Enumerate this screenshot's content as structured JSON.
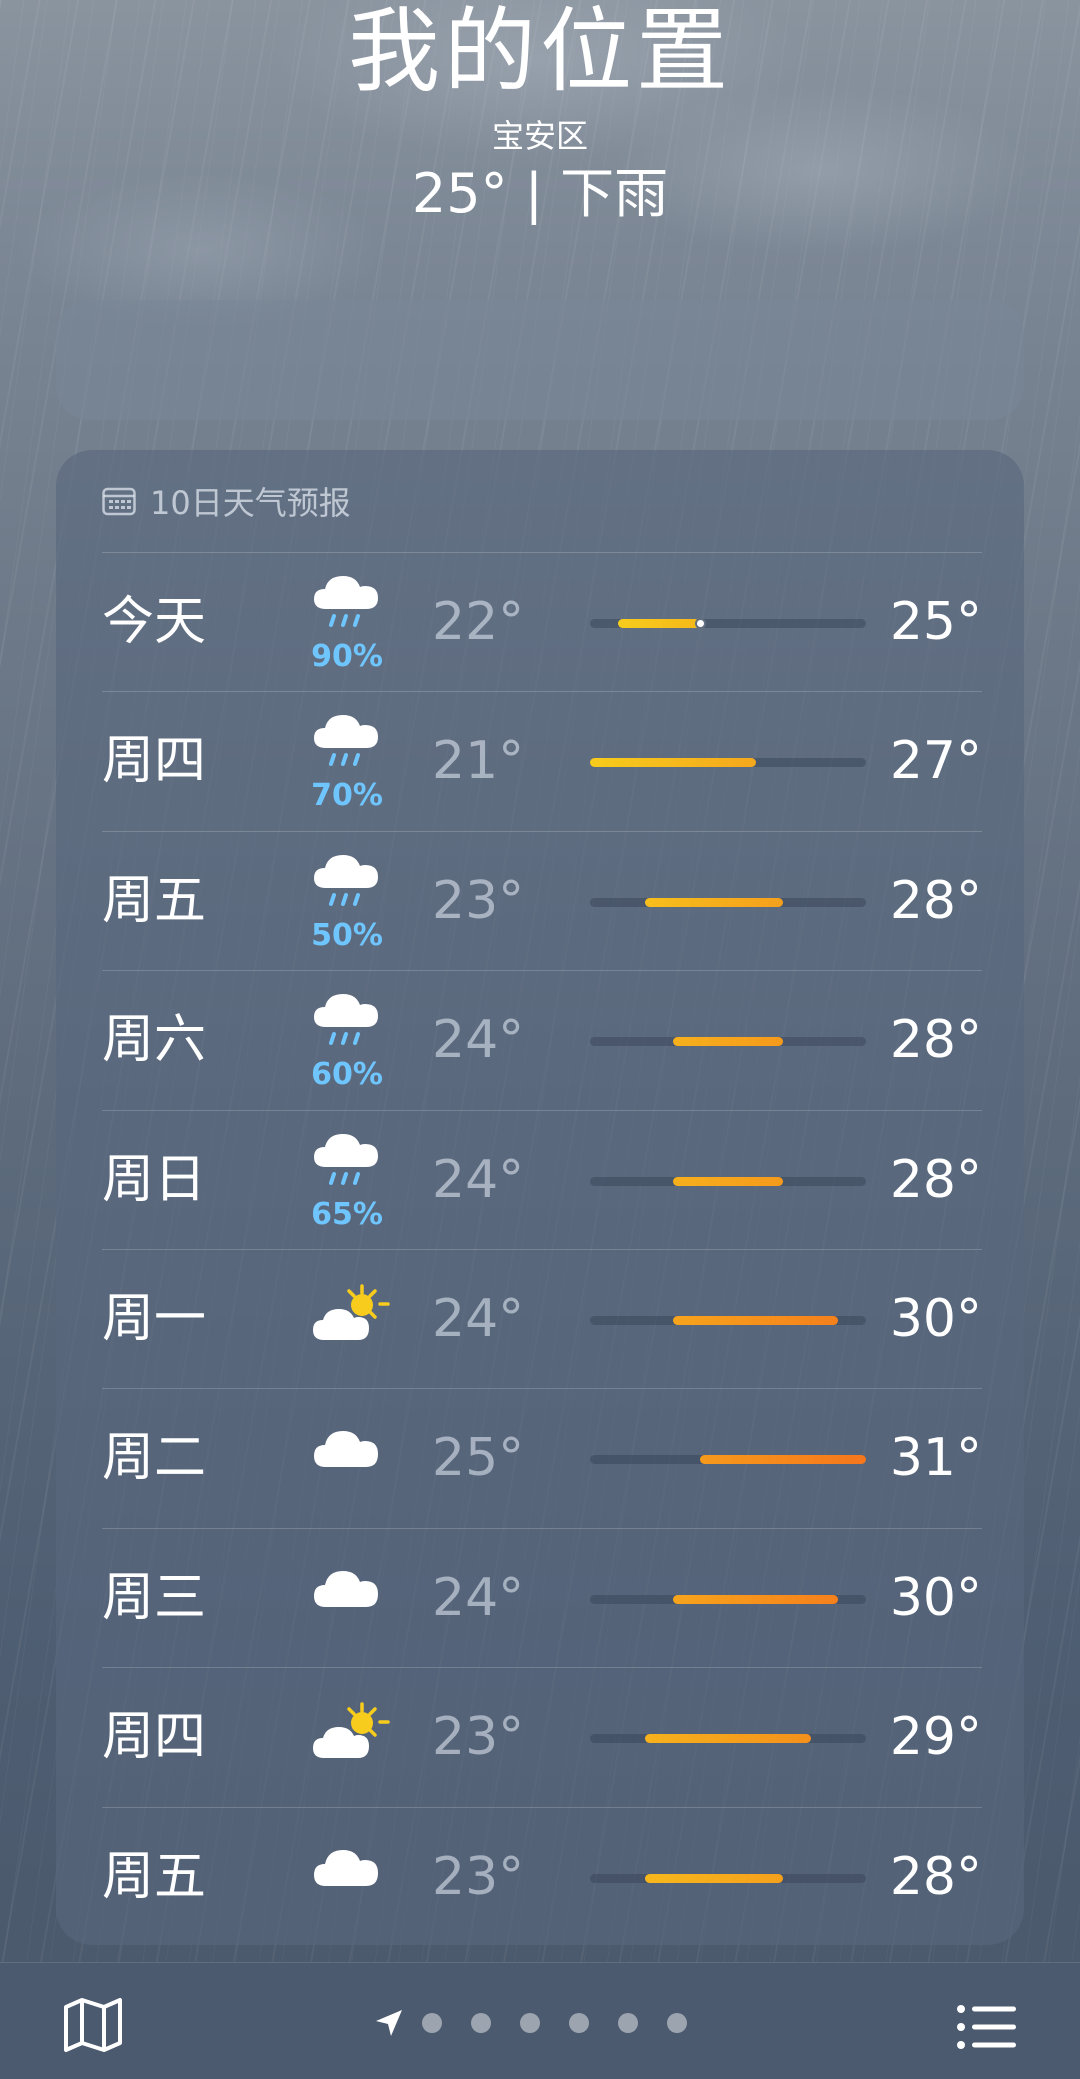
{
  "header": {
    "title": "我的位置",
    "subtitle": "宝安区",
    "current": "25° | 下雨"
  },
  "forecast": {
    "header_label": "10日天气预报",
    "header_icon": "calendar-icon",
    "range_min": 21,
    "range_max": 31,
    "current_temp": 25,
    "days": [
      {
        "day": "今天",
        "icon": "cloud-rain-icon",
        "pop": "90%",
        "low": "22°",
        "high": "25°",
        "low_v": 22,
        "high_v": 25,
        "color_a": "#f7cc1c",
        "color_b": "#f5b81a"
      },
      {
        "day": "周四",
        "icon": "cloud-rain-icon",
        "pop": "70%",
        "low": "21°",
        "high": "27°",
        "low_v": 21,
        "high_v": 27,
        "color_a": "#f7cc1c",
        "color_b": "#f5a81c"
      },
      {
        "day": "周五",
        "icon": "cloud-rain-icon",
        "pop": "50%",
        "low": "23°",
        "high": "28°",
        "low_v": 23,
        "high_v": 28,
        "color_a": "#f7bf1c",
        "color_b": "#f5a01c"
      },
      {
        "day": "周六",
        "icon": "cloud-rain-icon",
        "pop": "60%",
        "low": "24°",
        "high": "28°",
        "low_v": 24,
        "high_v": 28,
        "color_a": "#f7b01c",
        "color_b": "#f59a1c"
      },
      {
        "day": "周日",
        "icon": "cloud-rain-icon",
        "pop": "65%",
        "low": "24°",
        "high": "28°",
        "low_v": 24,
        "high_v": 28,
        "color_a": "#f7b01c",
        "color_b": "#f59a1c"
      },
      {
        "day": "周一",
        "icon": "partly-sunny-icon",
        "pop": "",
        "low": "24°",
        "high": "30°",
        "low_v": 24,
        "high_v": 30,
        "color_a": "#f7a41c",
        "color_b": "#f5801c"
      },
      {
        "day": "周二",
        "icon": "cloud-icon",
        "pop": "",
        "low": "25°",
        "high": "31°",
        "low_v": 25,
        "high_v": 31,
        "color_a": "#f79a1c",
        "color_b": "#f5761c"
      },
      {
        "day": "周三",
        "icon": "cloud-icon",
        "pop": "",
        "low": "24°",
        "high": "30°",
        "low_v": 24,
        "high_v": 30,
        "color_a": "#f7a41c",
        "color_b": "#f5801c"
      },
      {
        "day": "周四",
        "icon": "partly-sunny-icon",
        "pop": "",
        "low": "23°",
        "high": "29°",
        "low_v": 23,
        "high_v": 29,
        "color_a": "#f7b21c",
        "color_b": "#f5901c"
      },
      {
        "day": "周五",
        "icon": "cloud-icon",
        "pop": "",
        "low": "23°",
        "high": "28°",
        "low_v": 23,
        "high_v": 28,
        "color_a": "#f7b81c",
        "color_b": "#f5a01c"
      }
    ]
  },
  "bottom_bar": {
    "map_icon": "map-icon",
    "location_icon": "location-arrow-icon",
    "page_dots": 6,
    "list_icon": "list-icon"
  }
}
